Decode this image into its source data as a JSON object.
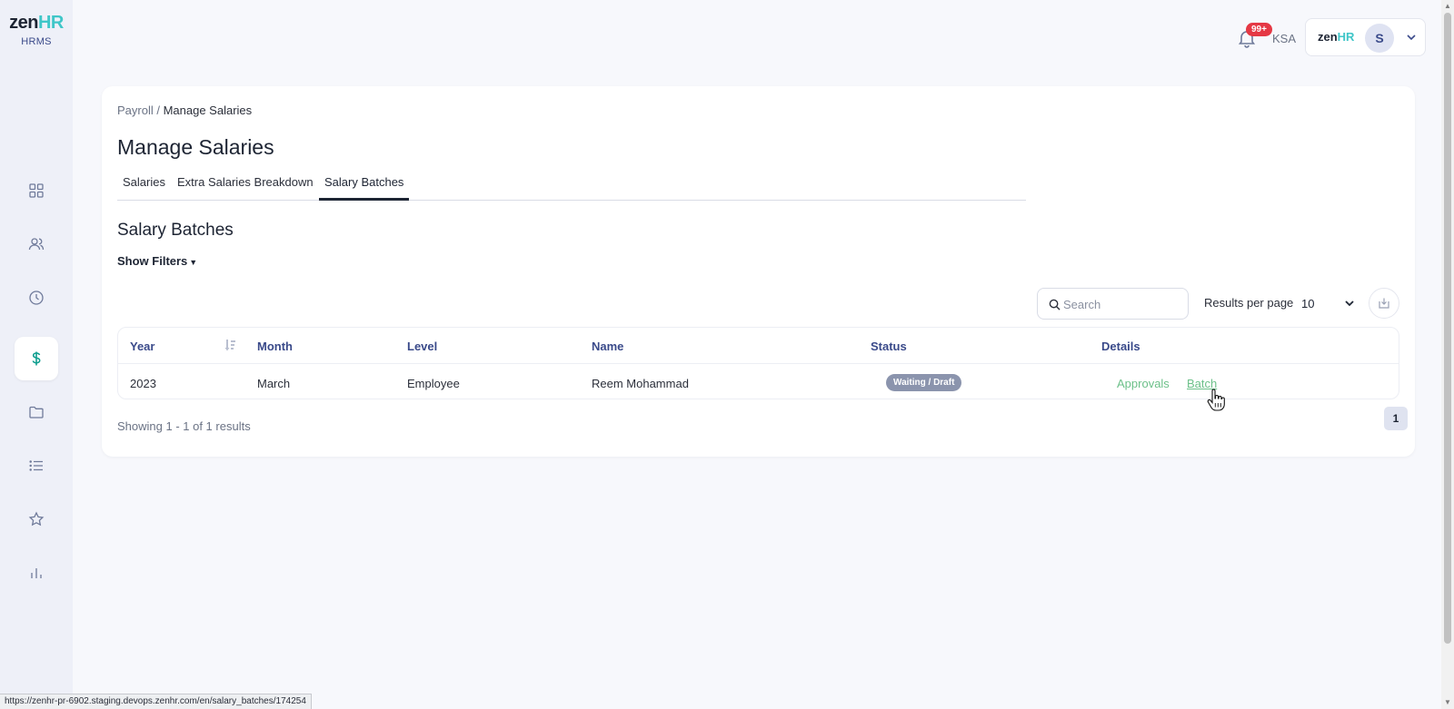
{
  "brand": {
    "logo_zen": "zen",
    "logo_hr": "HR",
    "product": "HRMS"
  },
  "sidebar": {
    "items": [
      {
        "name": "dashboard",
        "icon": "grid-icon",
        "active": false
      },
      {
        "name": "people",
        "icon": "users-icon",
        "active": false
      },
      {
        "name": "time",
        "icon": "clock-icon",
        "active": false
      },
      {
        "name": "payroll",
        "icon": "dollar-icon",
        "active": true
      },
      {
        "name": "documents",
        "icon": "folder-icon",
        "active": false
      },
      {
        "name": "requests",
        "icon": "list-icon",
        "active": false
      },
      {
        "name": "performance",
        "icon": "star-icon",
        "active": false
      },
      {
        "name": "reports",
        "icon": "bar-chart-icon",
        "active": false
      }
    ],
    "active_color": "#0f9e8f"
  },
  "topbar": {
    "notifications_badge": "99+",
    "region": "KSA",
    "company_logo_zen": "zen",
    "company_logo_hr": "HR",
    "avatar_initial": "S"
  },
  "breadcrumb": {
    "parent": "Payroll",
    "separator": " / ",
    "current": "Manage Salaries"
  },
  "page_title": "Manage Salaries",
  "tabs": [
    {
      "label": "Salaries",
      "active": false
    },
    {
      "label": "Extra Salaries Breakdown",
      "active": false
    },
    {
      "label": "Salary Batches",
      "active": true
    }
  ],
  "section_title": "Salary Batches",
  "filters_toggle": "Show Filters",
  "search": {
    "placeholder": "Search",
    "value": ""
  },
  "results_per_page": {
    "label": "Results per page",
    "value": "10"
  },
  "table": {
    "columns": [
      "Year",
      "Month",
      "Level",
      "Name",
      "Status",
      "Details"
    ],
    "rows": [
      {
        "year": "2023",
        "month": "March",
        "level": "Employee",
        "name": "Reem Mohammad",
        "status": "Waiting / Draft",
        "details_links": [
          "Approvals",
          "Batch"
        ]
      }
    ]
  },
  "pagination": {
    "summary": "Showing 1 - 1 of 1 results",
    "current_page": "1"
  },
  "status_bar_url": "https://zenhr-pr-6902.staging.devops.zenhr.com/en/salary_batches/174254",
  "colors": {
    "brand_teal": "#3fc6c8",
    "header_blue": "#3a4a8a",
    "link_green": "#6cc089",
    "badge_red": "#e53844",
    "status_gray": "#8b94ad"
  }
}
